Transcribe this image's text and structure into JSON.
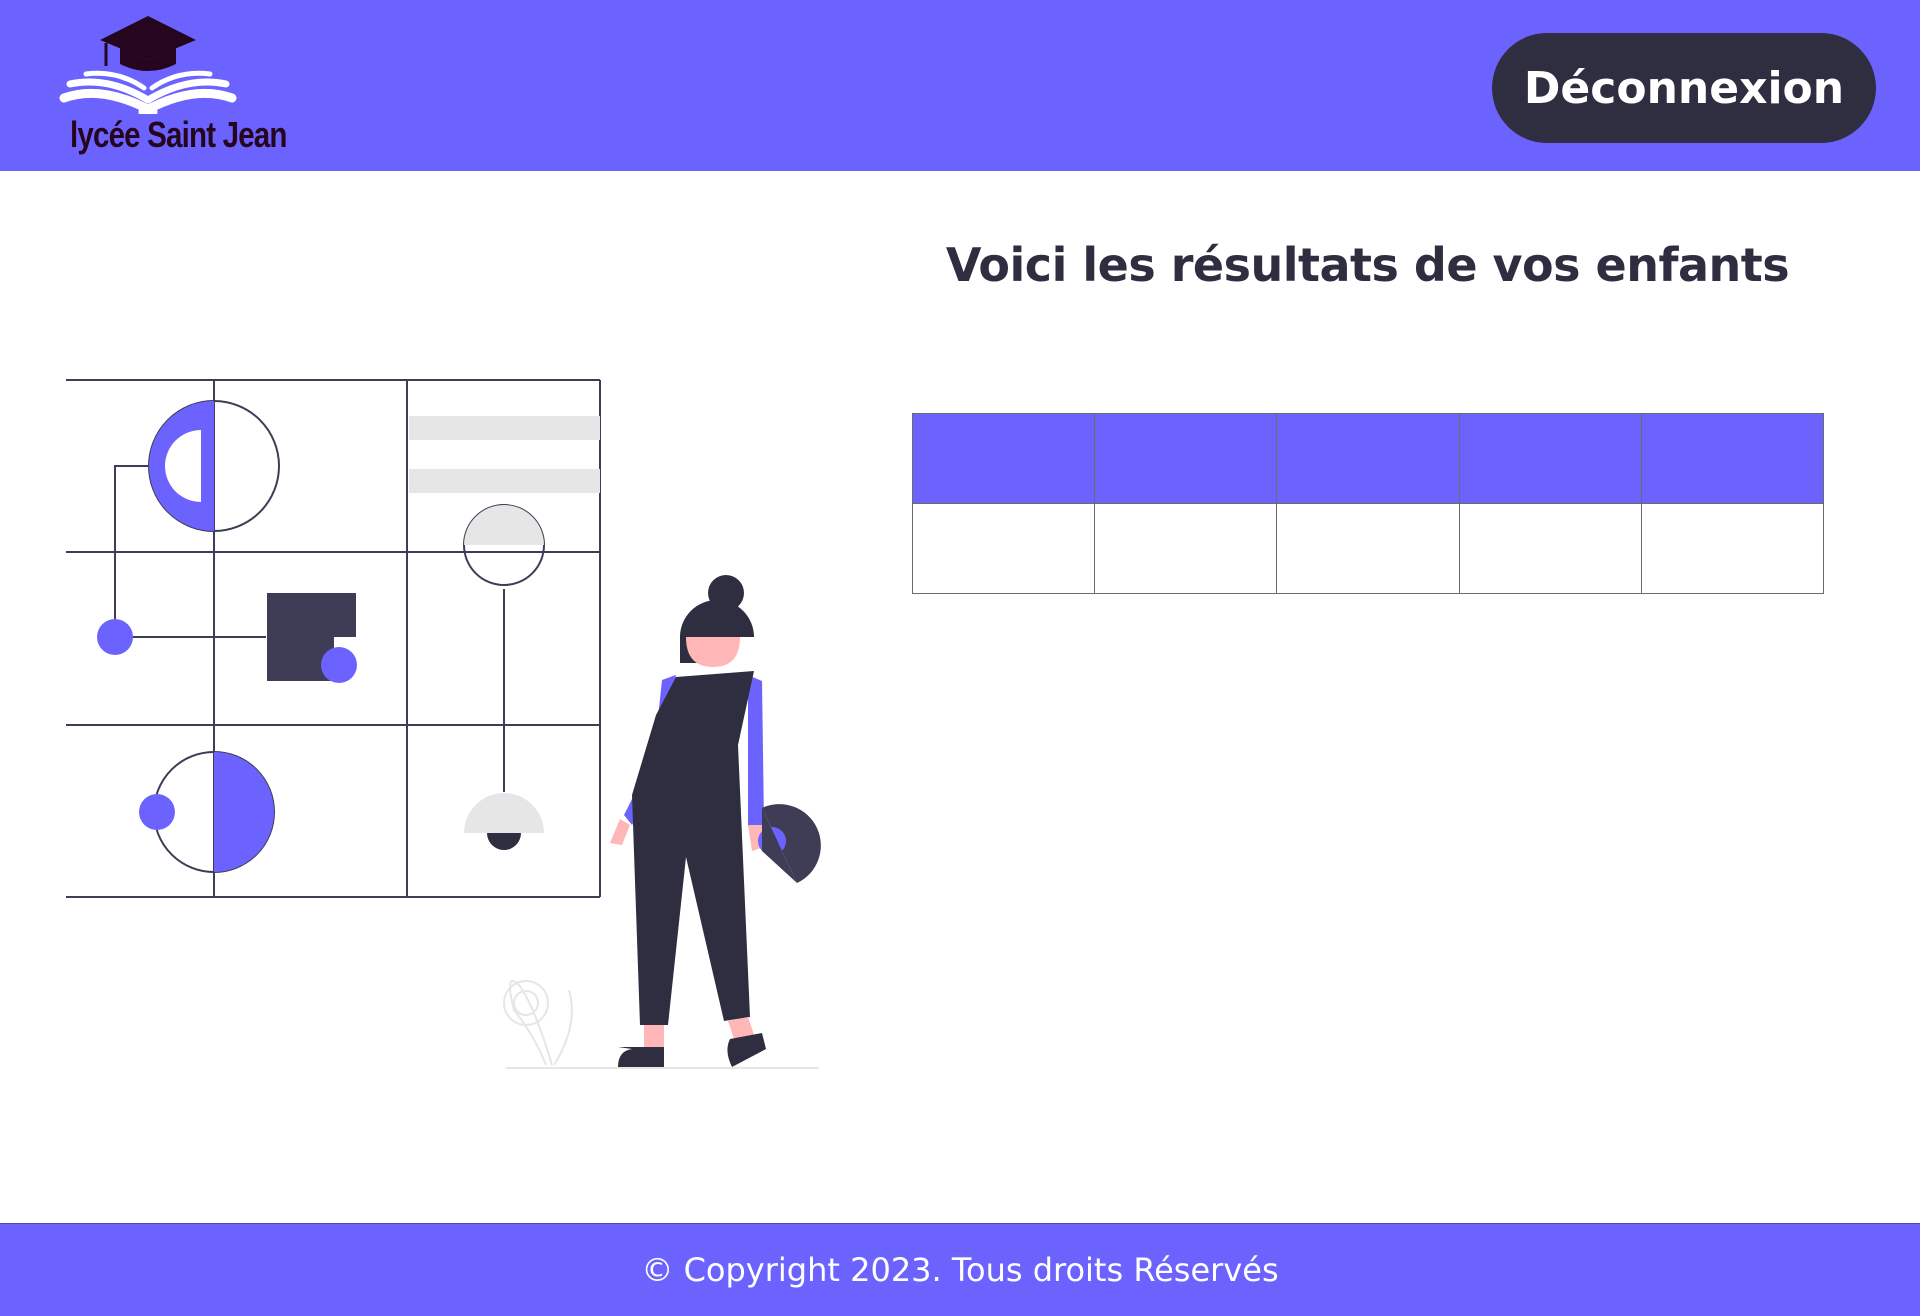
{
  "header": {
    "logo_text": "lycée Saint Jean",
    "logout_label": "Déconnexion"
  },
  "main": {
    "title": "Voici les résultats de vos enfants",
    "results_table": {
      "headers": [
        "",
        "",
        "",
        "",
        ""
      ],
      "rows": [
        [
          "",
          "",
          "",
          "",
          ""
        ]
      ]
    }
  },
  "footer": {
    "copyright": "© Copyright 2023. Tous droits Réservés"
  },
  "icons": {
    "logo": "graduation-cap-book-icon",
    "illustration": "woman-grid-illustration"
  },
  "colors": {
    "accent": "#6c63ff",
    "dark": "#2f2e41",
    "logo_text": "#26061f",
    "light_gray": "#e6e6e6",
    "skin": "#ffb6b6"
  }
}
